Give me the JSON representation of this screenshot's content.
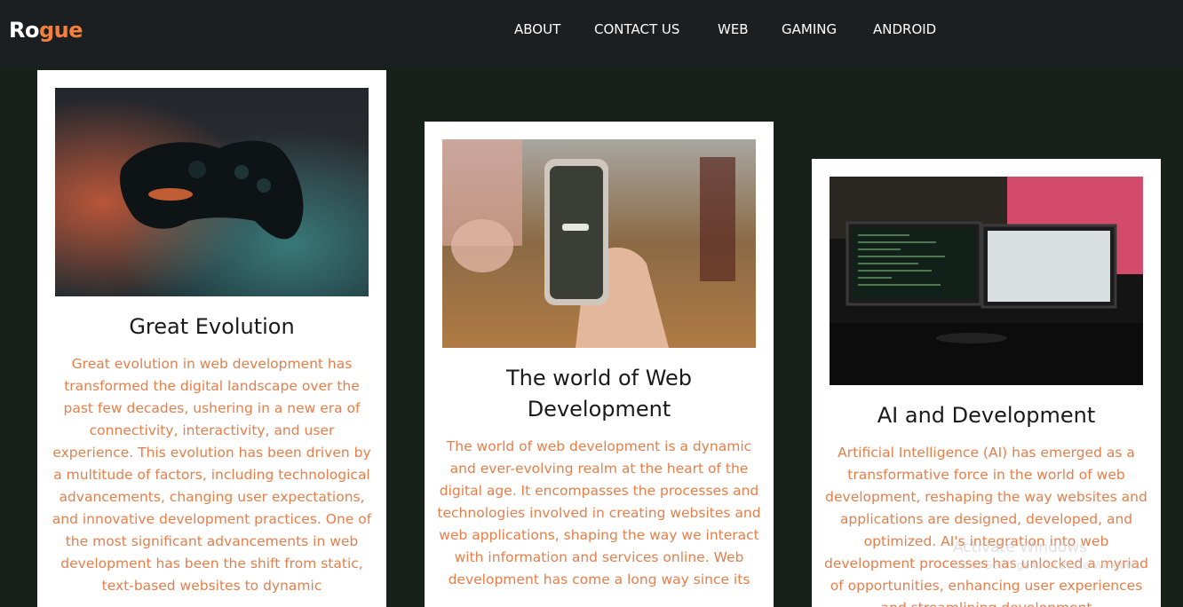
{
  "brand": {
    "logo_part1": "Ro",
    "logo_part2": "gue"
  },
  "nav": {
    "items": [
      "ABOUT",
      "CONTACT US",
      "WEB",
      "GAMING",
      "ANDROID"
    ]
  },
  "cards": [
    {
      "title": "Great Evolution",
      "image_alt": "game controller photo",
      "text": "Great evolution in web development has transformed the digital landscape over the past few decades, ushering in a new era of connectivity, interactivity, and user experience. This evolution has been driven by a multitude of factors, including technological advancements, changing user expectations, and innovative development practices. One of the most significant advancements in web development has been the shift from static, text-based websites to dynamic"
    },
    {
      "title": "The world of Web Development",
      "image_alt": "hand holding smartphone photo",
      "text": "The world of web development is a dynamic and ever-evolving realm at the heart of the digital age. It encompasses the processes and technologies involved in creating websites and web applications, shaping the way we interact with information and services online. Web development has come a long way since its"
    },
    {
      "title": "AI and Development",
      "image_alt": "monitors with code photo",
      "text": "Artificial Intelligence (AI) has emerged as a transformative force in the world of web development, reshaping the way websites and applications are designed, developed, and optimized. AI's integration into web development processes has unlocked a myriad of opportunities, enhancing user experiences and streamlining development"
    }
  ],
  "watermark": {
    "line1": "Activate Windows",
    "line2": "Go to Settings to activate Windows."
  },
  "colors": {
    "accent": "#f47f3a",
    "body_text": "#e67e4a",
    "navbar": "#1c1f22",
    "background": "#18201a"
  }
}
